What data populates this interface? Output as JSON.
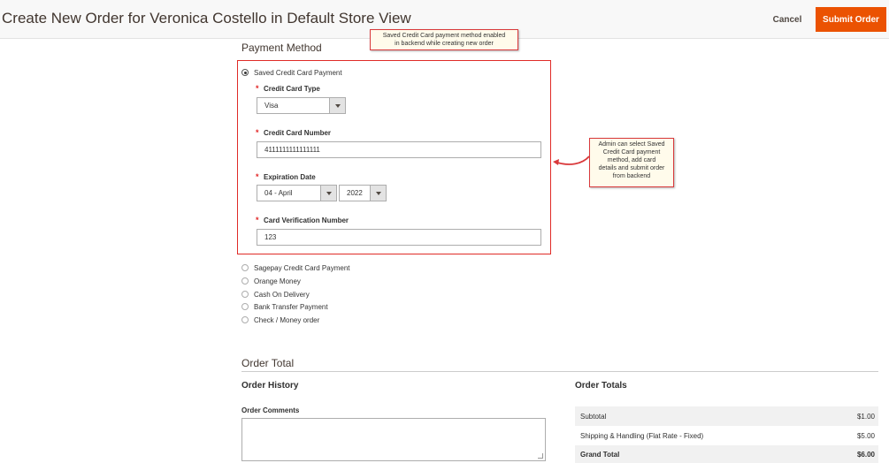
{
  "header": {
    "title": "Create New Order for Veronica Costello in Default Store View",
    "cancel_label": "Cancel",
    "submit_label": "Submit Order"
  },
  "payment": {
    "section_title": "Payment Method",
    "saved_card": {
      "label": "Saved Credit Card Payment",
      "selected": true,
      "fields": {
        "card_type_label": "Credit Card Type",
        "card_type_value": "Visa",
        "card_number_label": "Credit Card Number",
        "card_number_value": "4111111111111111",
        "expiration_label": "Expiration Date",
        "expiration_month": "04 - April",
        "expiration_year": "2022",
        "cvn_label": "Card Verification Number",
        "cvn_value": "123"
      }
    },
    "other_methods": [
      "Sagepay Credit Card Payment",
      "Orange Money",
      "Cash On Delivery",
      "Bank Transfer Payment",
      "Check / Money order"
    ]
  },
  "annotations": {
    "top_line1": "Saved Credit Card payment method enabled",
    "top_line2": "in backend while creating new order",
    "side_line1": "Admin can select Saved",
    "side_line2": "Credit Card payment",
    "side_line3": "method, add card",
    "side_line4": "details and submit order",
    "side_line5": "from backend",
    "border_color": "#d9393b"
  },
  "order_total": {
    "section_title": "Order Total",
    "history_title": "Order History",
    "comments_label": "Order Comments",
    "totals_title": "Order Totals",
    "rows": [
      {
        "label": "Subtotal",
        "amount": "$1.00"
      },
      {
        "label": "Shipping & Handling (Flat Rate - Fixed)",
        "amount": "$5.00"
      },
      {
        "label": "Grand Total",
        "amount": "$6.00"
      }
    ]
  },
  "colors": {
    "accent": "#eb5202",
    "error_border": "#e02b27",
    "required": "#e22626"
  },
  "icons": {
    "dropdown": "chevron-down-icon",
    "annotation_arrow": "curved-arrow-icon",
    "resize": "resize-grip-icon"
  }
}
